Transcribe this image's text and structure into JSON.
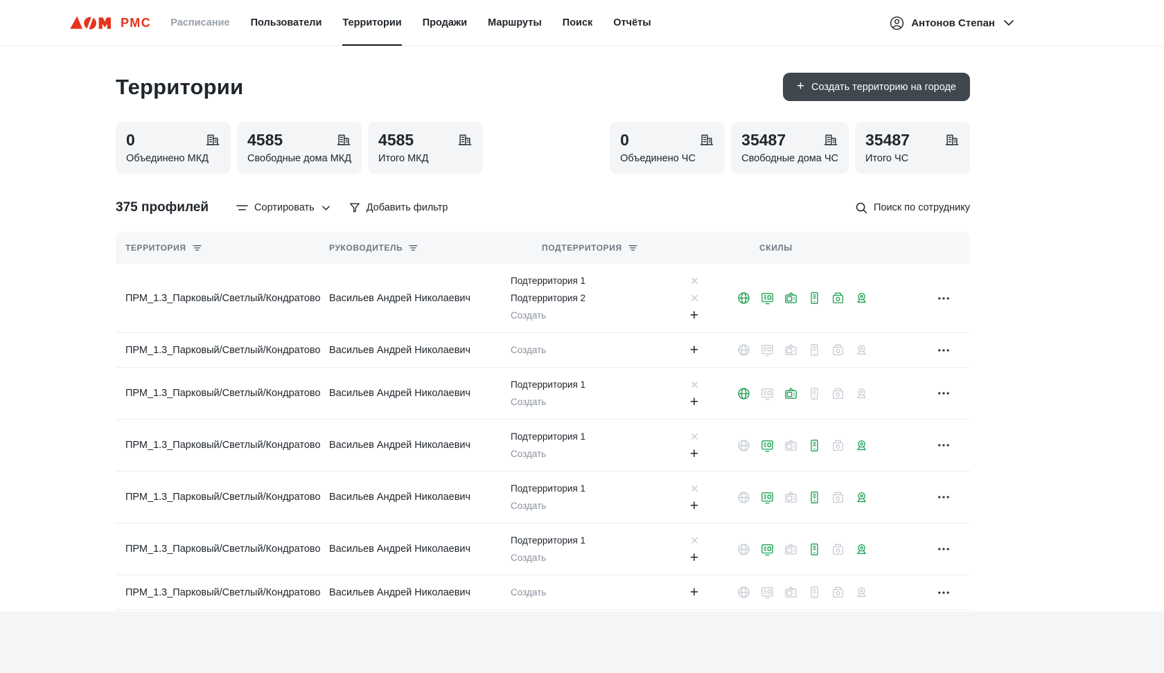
{
  "header": {
    "logo_text": "РМС",
    "nav": [
      {
        "id": "schedule",
        "label": "Расписание",
        "disabled": true
      },
      {
        "id": "users",
        "label": "Пользователи"
      },
      {
        "id": "territories",
        "label": "Территории",
        "active": true
      },
      {
        "id": "sales",
        "label": "Продажи"
      },
      {
        "id": "routes",
        "label": "Маршруты"
      },
      {
        "id": "search",
        "label": "Поиск"
      },
      {
        "id": "reports",
        "label": "Отчёты"
      }
    ],
    "user_name": "Антонов Степан"
  },
  "page": {
    "title": "Территории",
    "create_button_label": "Создать территорию на городе"
  },
  "stats": {
    "mkd": [
      {
        "value": "0",
        "label": "Объединено МКД"
      },
      {
        "value": "4585",
        "label": "Свободные дома МКД"
      },
      {
        "value": "4585",
        "label": "Итого МКД"
      }
    ],
    "chs": [
      {
        "value": "0",
        "label": "Объединено ЧС"
      },
      {
        "value": "35487",
        "label": "Свободные дома ЧС"
      },
      {
        "value": "35487",
        "label": "Итого ЧС"
      }
    ]
  },
  "toolbar": {
    "count": "375 профилей",
    "sort_label": "Сортировать",
    "filter_label": "Добавить фильтр",
    "search_label": "Поиск по сотруднику"
  },
  "table": {
    "columns": {
      "territory": "ТЕРРИТОРИЯ",
      "manager": "РУКОВОДИТЕЛЬ",
      "subterritory": "ПОДТЕРРИТОРИЯ",
      "skills": "СКИЛЫ"
    },
    "create_label": "Создать",
    "skills_order": [
      "internet",
      "iptv",
      "tv",
      "receipt",
      "phone",
      "camera"
    ],
    "rows": [
      {
        "territory": "ПРМ_1.3_Парковый/Светлый/Кондратово",
        "manager": "Васильев Андрей Николаевич",
        "subterritories": [
          "Подтерритория 1",
          "Подтерритория 2"
        ],
        "skills": [
          true,
          true,
          true,
          true,
          true,
          true
        ]
      },
      {
        "territory": "ПРМ_1.3_Парковый/Светлый/Кондратово",
        "manager": "Васильев Андрей Николаевич",
        "subterritories": [],
        "skills": [
          false,
          false,
          false,
          false,
          false,
          false
        ]
      },
      {
        "territory": "ПРМ_1.3_Парковый/Светлый/Кондратово",
        "manager": "Васильев Андрей Николаевич",
        "subterritories": [
          "Подтерритория 1"
        ],
        "skills": [
          true,
          false,
          true,
          false,
          false,
          false
        ]
      },
      {
        "territory": "ПРМ_1.3_Парковый/Светлый/Кондратово",
        "manager": "Васильев Андрей Николаевич",
        "subterritories": [
          "Подтерритория 1"
        ],
        "skills": [
          false,
          true,
          false,
          true,
          false,
          true
        ]
      },
      {
        "territory": "ПРМ_1.3_Парковый/Светлый/Кондратово",
        "manager": "Васильев Андрей Николаевич",
        "subterritories": [
          "Подтерритория 1"
        ],
        "skills": [
          false,
          true,
          false,
          true,
          false,
          true
        ]
      },
      {
        "territory": "ПРМ_1.3_Парковый/Светлый/Кондратово",
        "manager": "Васильев Андрей Николаевич",
        "subterritories": [
          "Подтерритория 1"
        ],
        "skills": [
          false,
          true,
          false,
          true,
          false,
          true
        ]
      },
      {
        "territory": "ПРМ_1.3_Парковый/Светлый/Кондратово",
        "manager": "Васильев Андрей Николаевич",
        "subterritories": [],
        "skills": [
          false,
          false,
          false,
          false,
          false,
          false
        ]
      }
    ]
  },
  "colors": {
    "brand_red": "#e4341c",
    "skill_active": "#1f9e51",
    "skill_inactive": "#c7cdd4",
    "button_bg": "#40474f"
  }
}
